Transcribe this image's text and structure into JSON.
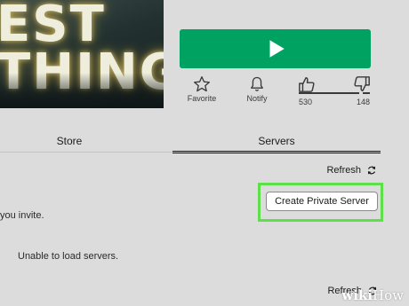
{
  "thumbnail": {
    "line1": "EST",
    "line2": "THING"
  },
  "play_button": {
    "icon": "play-icon",
    "color": "#00a262"
  },
  "actions": {
    "favorite": {
      "icon": "star-icon",
      "label": "Favorite"
    },
    "notify": {
      "icon": "bell-icon",
      "label": "Notify"
    }
  },
  "votes": {
    "up_icon": "thumbs-up-icon",
    "down_icon": "thumbs-down-icon",
    "up": "530",
    "down": "148",
    "up_ratio": 0.78
  },
  "tabs": [
    {
      "label": "Store",
      "active": false
    },
    {
      "label": "Servers",
      "active": true
    }
  ],
  "servers": {
    "refresh_label": "Refresh",
    "create_button": "Create Private Server",
    "invite_text": "you invite.",
    "unable_text": "Unable to load servers.",
    "refresh_label_bottom": "Refresh"
  },
  "highlight_color": "#5ee04a",
  "watermark": {
    "part1": "wiki",
    "part2": "How"
  }
}
